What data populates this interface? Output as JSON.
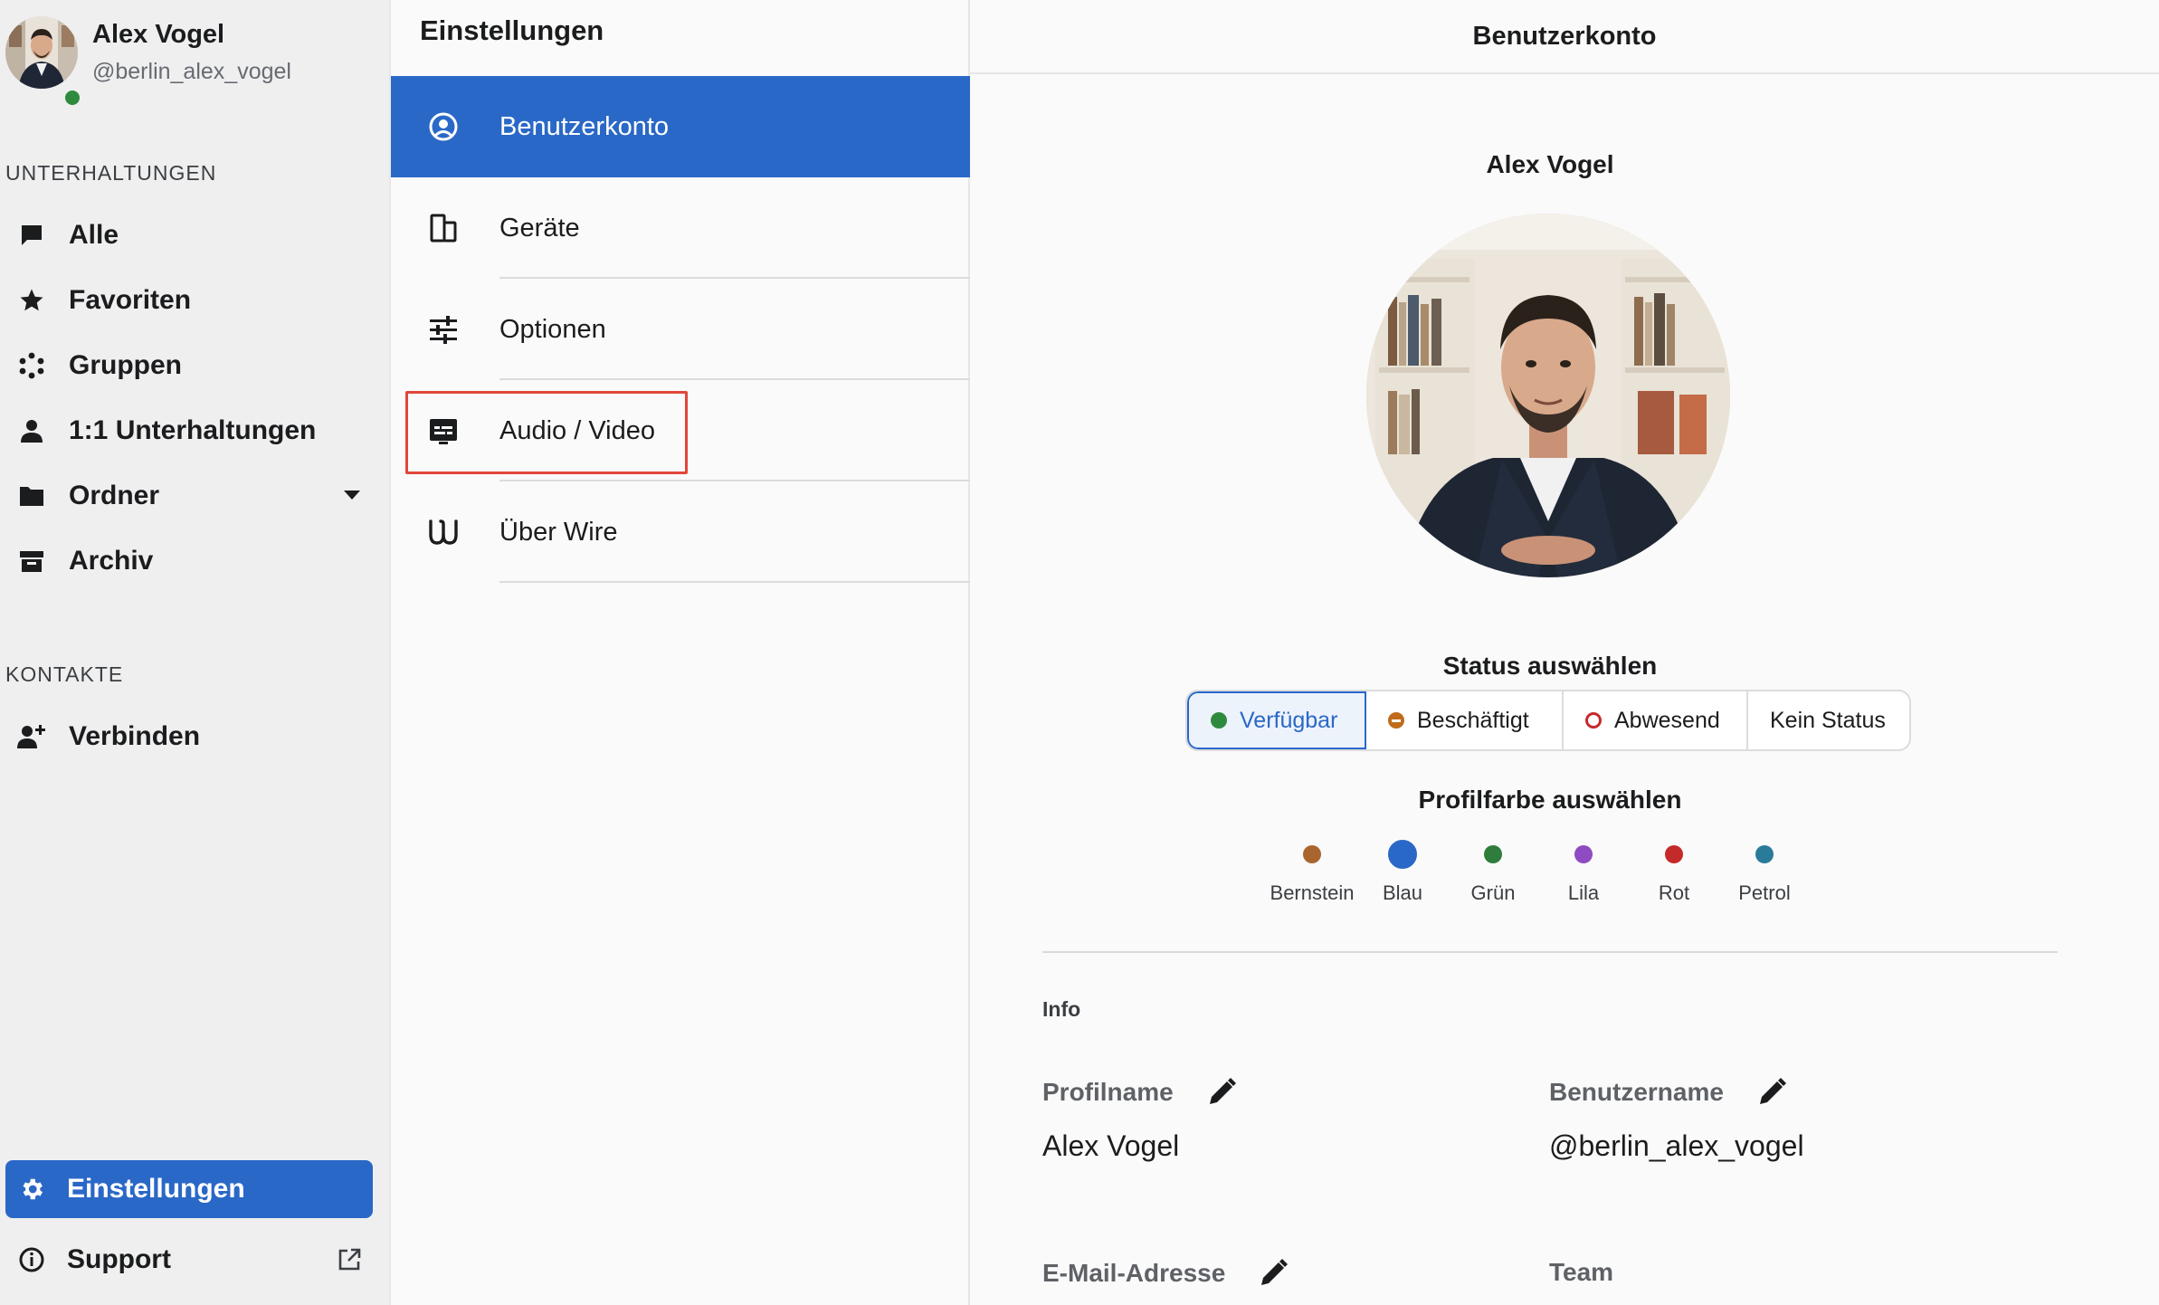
{
  "user": {
    "name": "Alex Vogel",
    "handle": "@berlin_alex_vogel",
    "status_color": "#2e8b3e"
  },
  "sidebar": {
    "conversations_label": "UNTERHALTUNGEN",
    "conversations": [
      {
        "label": "Alle",
        "icon": "chat-bubble-icon"
      },
      {
        "label": "Favoriten",
        "icon": "star-icon"
      },
      {
        "label": "Gruppen",
        "icon": "group-dots-icon"
      },
      {
        "label": "1:1 Unterhaltungen",
        "icon": "person-icon"
      },
      {
        "label": "Ordner",
        "icon": "folder-icon"
      },
      {
        "label": "Archiv",
        "icon": "archive-icon"
      }
    ],
    "contacts_label": "KONTAKTE",
    "contacts": [
      {
        "label": "Verbinden",
        "icon": "add-person-icon"
      }
    ],
    "settings_label": "Einstellungen",
    "support_label": "Support"
  },
  "settings_menu": {
    "title": "Einstellungen",
    "items": [
      {
        "label": "Benutzerkonto",
        "icon": "account-circle-icon",
        "active": true
      },
      {
        "label": "Geräte",
        "icon": "devices-icon",
        "active": false
      },
      {
        "label": "Optionen",
        "icon": "sliders-icon",
        "active": false
      },
      {
        "label": "Audio / Video",
        "icon": "audio-video-icon",
        "active": false,
        "highlighted": true
      },
      {
        "label": "Über Wire",
        "icon": "wire-logo-icon",
        "active": false
      }
    ]
  },
  "account": {
    "header": "Benutzerkonto",
    "profile_name": "Alex Vogel",
    "status_title": "Status auswählen",
    "statuses": [
      {
        "label": "Verfügbar",
        "selected": true
      },
      {
        "label": "Beschäftigt",
        "selected": false
      },
      {
        "label": "Abwesend",
        "selected": false
      },
      {
        "label": "Kein Status",
        "selected": false
      }
    ],
    "color_title": "Profilfarbe auswählen",
    "colors": [
      {
        "label": "Bernstein",
        "hex": "#a8662e",
        "selected": false
      },
      {
        "label": "Blau",
        "hex": "#2a68c7",
        "selected": true
      },
      {
        "label": "Grün",
        "hex": "#2e7d3c",
        "selected": false
      },
      {
        "label": "Lila",
        "hex": "#8f4bc1",
        "selected": false
      },
      {
        "label": "Rot",
        "hex": "#c42a2a",
        "selected": false
      },
      {
        "label": "Petrol",
        "hex": "#2a7a9a",
        "selected": false
      }
    ],
    "info_label": "Info",
    "fields": {
      "profile_name_label": "Profilname",
      "profile_name_value": "Alex Vogel",
      "username_label": "Benutzername",
      "username_value": "@berlin_alex_vogel",
      "email_label": "E-Mail-Adresse",
      "team_label": "Team"
    }
  },
  "colors": {
    "accent": "#2a68c7",
    "highlight_border": "#e0473b"
  }
}
